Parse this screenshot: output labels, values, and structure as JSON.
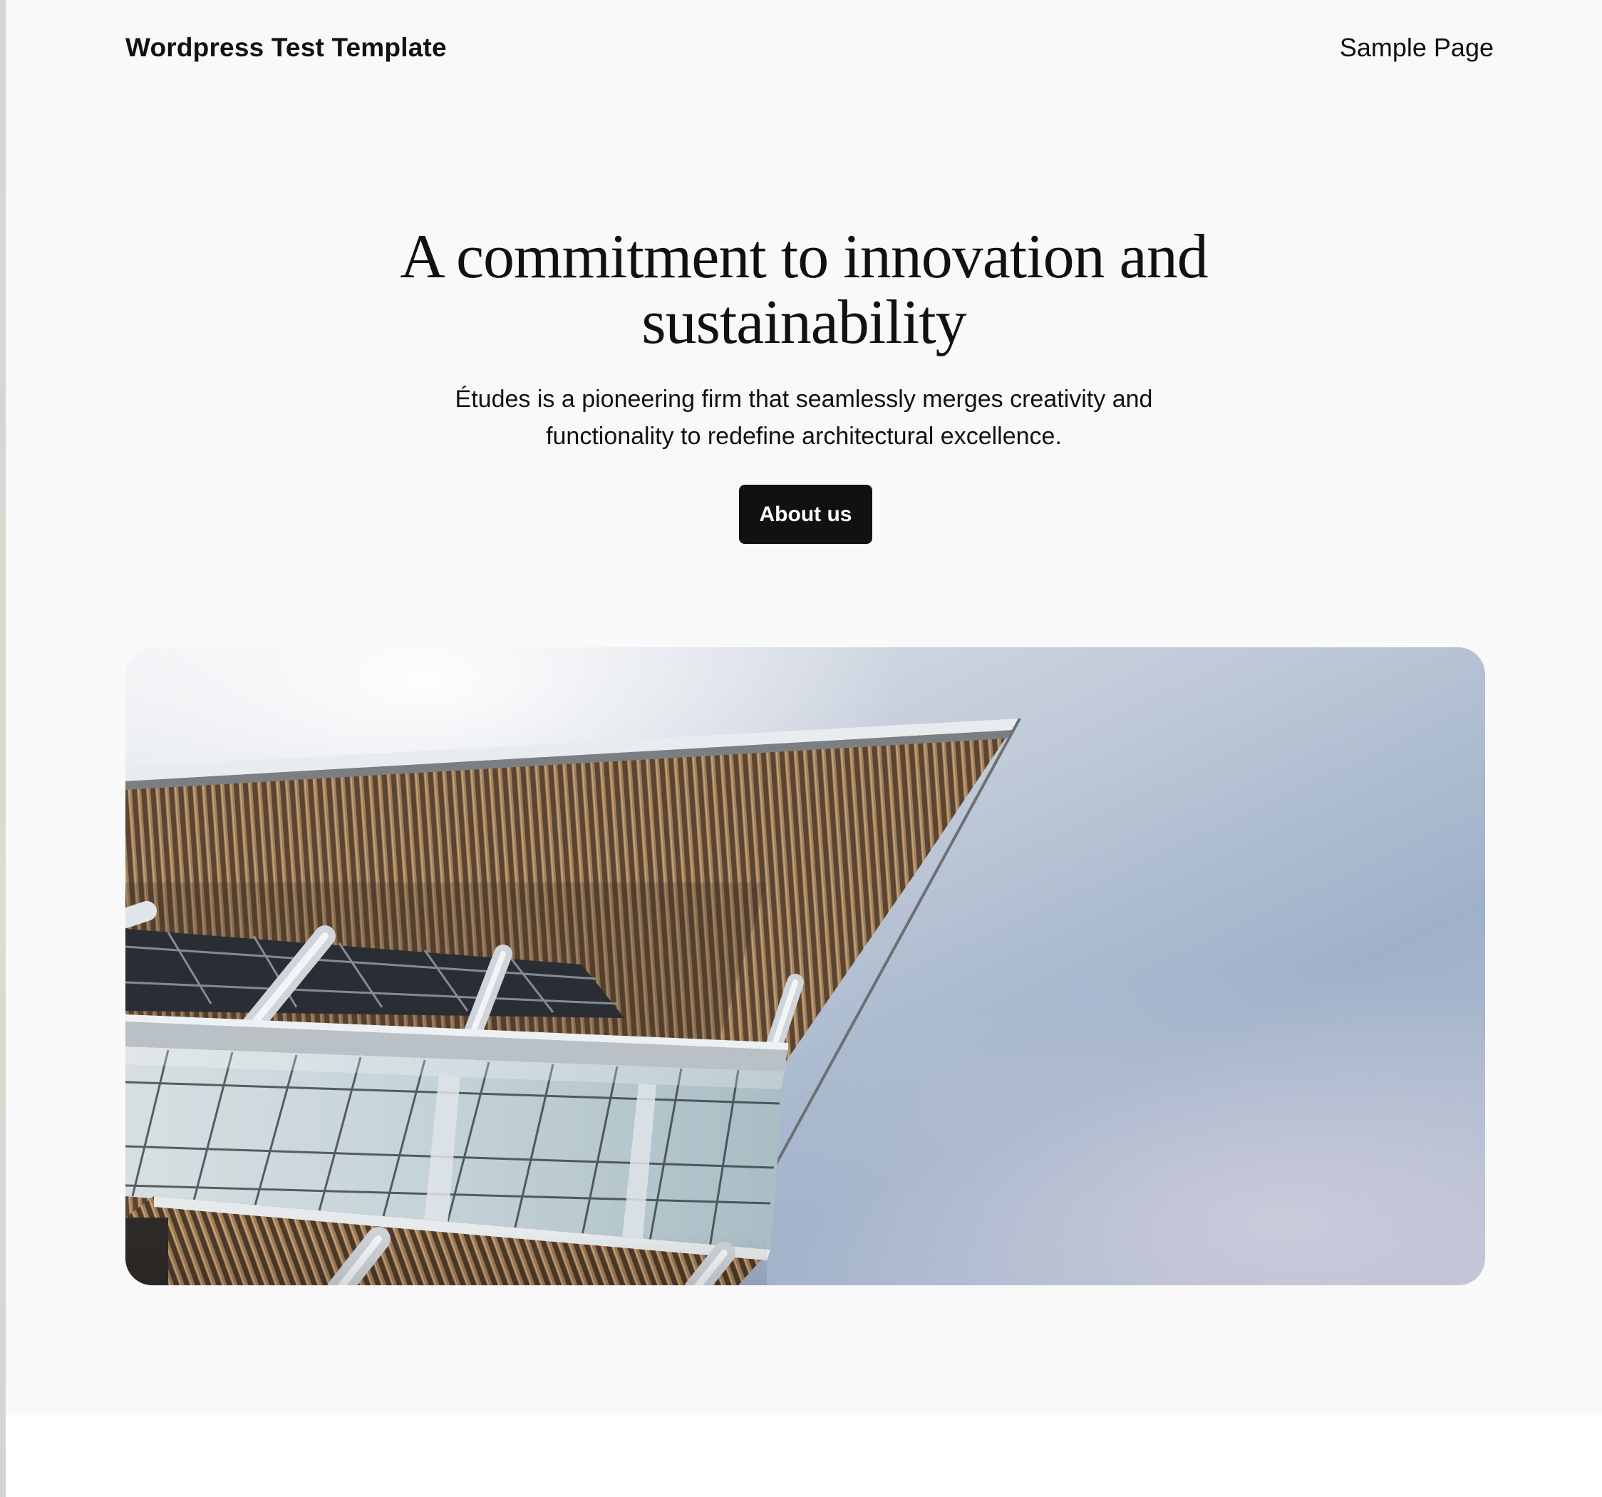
{
  "header": {
    "site_title": "Wordpress Test Template",
    "nav": [
      {
        "label": "Sample Page"
      }
    ]
  },
  "hero": {
    "heading_line1": "A commitment to innovation and",
    "heading_line2": "sustainability",
    "subtitle_line1": "Études is a pioneering firm that seamlessly merges creativity and",
    "subtitle_line2": "functionality to redefine architectural excellence.",
    "cta_label": "About us",
    "image": {
      "subject": "building-canopy-against-sky",
      "colors": {
        "sky": "#a2b4cc",
        "slats": "#8a6a48",
        "glass": "#c5d2d6",
        "beam": "#d8dde0"
      }
    }
  },
  "colors": {
    "page_background": "#f9f9f9",
    "text": "#111111",
    "button_background": "#111111",
    "button_text": "#ffffff"
  }
}
